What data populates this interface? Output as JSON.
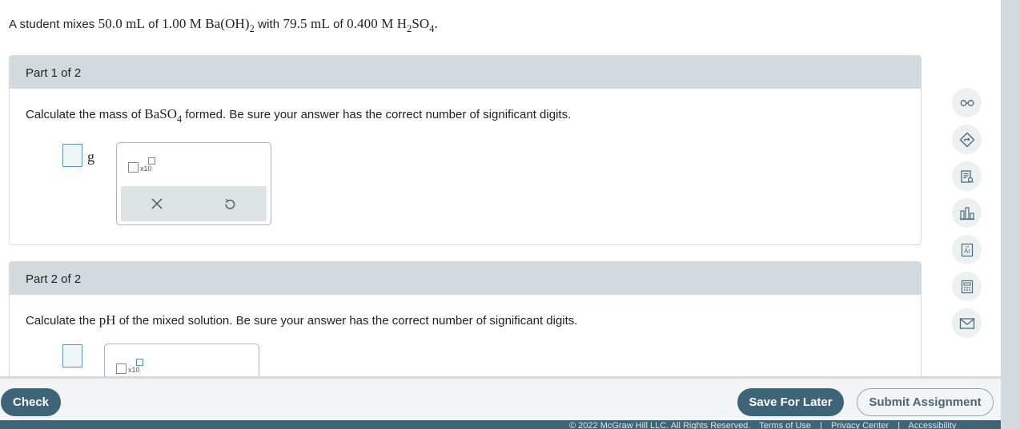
{
  "question": {
    "intro_text": "A student mixes",
    "vol1": "50.0 mL",
    "of1": "of",
    "conc1": "1.00 M",
    "formula1_main": "Ba(OH)",
    "formula1_sub": "2",
    "with_text": "with",
    "vol2": "79.5 mL",
    "of2": "of",
    "conc2": "0.400 M",
    "formula2_h": "H",
    "formula2_sub1": "2",
    "formula2_so": "SO",
    "formula2_sub2": "4",
    "period": "."
  },
  "part1": {
    "title": "Part 1 of 2",
    "prompt_before": "Calculate the mass of",
    "formula_main": "BaSO",
    "formula_sub": "4",
    "prompt_after": "formed. Be sure your answer has the correct number of significant digits.",
    "unit": "g",
    "sci_label": "x10",
    "answer_value": ""
  },
  "part2": {
    "title": "Part 2 of 2",
    "prompt_before": "Calculate the",
    "ph_label": "pH",
    "prompt_after": "of the mixed solution. Be sure your answer has the correct number of significant digits.",
    "sci_label": "x10",
    "answer_value": ""
  },
  "palette_icons": [
    "clear-x-icon",
    "undo-icon"
  ],
  "right_rail": [
    {
      "icon": "glasses-icon"
    },
    {
      "icon": "hint-arrow-icon"
    },
    {
      "icon": "textbook-icon"
    },
    {
      "icon": "bar-chart-icon"
    },
    {
      "icon": "periodic-table-icon"
    },
    {
      "icon": "calculator-icon"
    },
    {
      "icon": "mail-icon"
    }
  ],
  "footer": {
    "check_label": "Check",
    "save_label": "Save For Later",
    "submit_label": "Submit Assignment"
  },
  "copyright": {
    "text": "© 2022 McGraw Hill LLC. All Rights Reserved.",
    "terms": "Terms of Use",
    "sep1": "|",
    "privacy": "Privacy Center",
    "sep2": "|",
    "accessibility": "Accessibility"
  },
  "colors": {
    "header_bg": "#d3dade",
    "primary_button": "#3e6577",
    "input_border": "#5a93a8"
  }
}
